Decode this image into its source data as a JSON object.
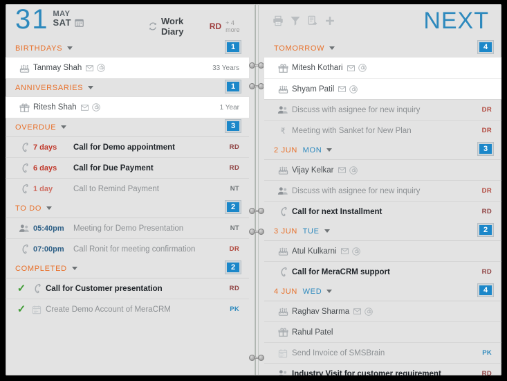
{
  "colors": {
    "accent_blue": "#2d89bd",
    "badge_blue": "#1b87c9",
    "orange": "#e8702a",
    "red": "#c0392b",
    "green": "#3f9c35"
  },
  "left_header": {
    "day_number": "31",
    "month": "MAY",
    "weekday": "SAT",
    "calendar_icon": "calendar-icon",
    "refresh_icon": "refresh-icon",
    "diary_title": "Work Diary",
    "diary_user": "RD",
    "diary_more": "+ 4 more"
  },
  "right_header": {
    "title": "NEXT",
    "tools": [
      {
        "name": "print-icon",
        "label": "Print"
      },
      {
        "name": "filter-icon",
        "label": "Filter"
      },
      {
        "name": "export-icon",
        "label": "Export"
      },
      {
        "name": "add-icon",
        "label": "Add"
      }
    ]
  },
  "left_sections": [
    {
      "title": "BIRTHDAYS",
      "count": "1",
      "white": true,
      "rows": [
        {
          "icon": "cake-icon",
          "name": "Tanmay Shah",
          "mini": [
            "mail-icon",
            "at-icon"
          ],
          "meta": "33 Years"
        }
      ]
    },
    {
      "title": "ANNIVERSARIES",
      "count": "1",
      "white": true,
      "rows": [
        {
          "icon": "gift-icon",
          "name": "Ritesh Shah",
          "mini": [
            "mail-icon",
            "at-icon"
          ],
          "meta": "1 Year"
        }
      ]
    },
    {
      "title": "OVERDUE",
      "count": "3",
      "white": false,
      "rows": [
        {
          "icon": "phone-icon",
          "time": "7 days",
          "time_style": "ovr",
          "task": "Call for Demo appointment",
          "task_bold": true,
          "label": "RD",
          "label_style": "rl-rd"
        },
        {
          "icon": "phone-icon",
          "time": "6 days",
          "time_style": "ovr",
          "task": "Call for Due Payment",
          "task_bold": true,
          "label": "RD",
          "label_style": "rl-rd"
        },
        {
          "icon": "phone-icon",
          "time": "1 day",
          "time_style": "ovrdim",
          "task": "Call to Remind Payment",
          "task_bold": false,
          "label": "NT",
          "label_style": "rl-nt"
        }
      ]
    },
    {
      "title": "TO DO",
      "count": "2",
      "white": false,
      "rows": [
        {
          "icon": "people-icon",
          "time": "05:40pm",
          "task": "Meeting for Demo Presentation",
          "task_bold": false,
          "label": "NT",
          "label_style": "rl-nt"
        },
        {
          "icon": "phone-icon",
          "time": "07:00pm",
          "task": "Call Ronit for meeting confirmation",
          "task_bold": false,
          "label": "DR",
          "label_style": "rl-dr"
        }
      ]
    },
    {
      "title": "COMPLETED",
      "count": "2",
      "white": false,
      "checks": true,
      "rows": [
        {
          "check": "✓",
          "icon": "phone-icon",
          "task": "Call  for Customer presentation",
          "task_bold": true,
          "label": "RD",
          "label_style": "rl-rd"
        },
        {
          "check": "✓",
          "icon": "calendar-icon",
          "task": "Create Demo Account of MeraCRM",
          "task_bold": false,
          "label": "PK",
          "label_style": "rl-pk"
        }
      ]
    }
  ],
  "right_sections": [
    {
      "title": "TOMORROW",
      "count": "4",
      "white_rows": 2,
      "rows": [
        {
          "icon": "gift-icon",
          "name": "Mitesh Kothari",
          "mini": [
            "mail-icon",
            "at-icon"
          ],
          "white": true
        },
        {
          "icon": "cake-icon",
          "name": "Shyam Patil",
          "mini": [
            "mail-icon",
            "at-icon"
          ],
          "white": true
        },
        {
          "icon": "people-icon",
          "task": "Discuss with asignee for new inquiry",
          "task_bold": false,
          "label": "DR",
          "label_style": "rl-dr"
        },
        {
          "icon": "rupee-icon",
          "task": "Meeting with Sanket for New Plan",
          "task_bold": false,
          "label": "DR",
          "label_style": "rl-dr"
        }
      ]
    },
    {
      "date": "2 JUN",
      "weekday": "MON",
      "count": "3",
      "rows": [
        {
          "icon": "cake-icon",
          "name": "Vijay Kelkar",
          "mini": [
            "mail-icon",
            "at-icon"
          ]
        },
        {
          "icon": "people-icon",
          "task": "Discuss with asignee for new inquiry",
          "task_bold": false,
          "label": "DR",
          "label_style": "rl-dr"
        },
        {
          "icon": "phone-icon",
          "task": "Call for next Installment",
          "task_bold": true,
          "label": "RD",
          "label_style": "rl-rd"
        }
      ]
    },
    {
      "date": "3 JUN",
      "weekday": "TUE",
      "count": "2",
      "rows": [
        {
          "icon": "cake-icon",
          "name": "Atul Kulkarni",
          "mini": [
            "mail-icon",
            "at-icon"
          ]
        },
        {
          "icon": "phone-icon",
          "task": "Call for MeraCRM support",
          "task_bold": true,
          "label": "RD",
          "label_style": "rl-rd"
        }
      ]
    },
    {
      "date": "4 JUN",
      "weekday": "WED",
      "count": "4",
      "rows": [
        {
          "icon": "cake-icon",
          "name": "Raghav Sharma",
          "mini": [
            "mail-icon",
            "at-icon"
          ]
        },
        {
          "icon": "gift-icon",
          "name": "Rahul Patel",
          "mini": []
        },
        {
          "icon": "calendar-icon",
          "task": "Send Invoice of SMSBrain",
          "task_bold": false,
          "label": "PK",
          "label_style": "rl-pk"
        },
        {
          "icon": "people-icon",
          "task": "Industry Visit for customer requirement",
          "task_bold": true,
          "label": "RD",
          "label_style": "rl-rd"
        }
      ]
    }
  ],
  "binder": {
    "ring_pairs": 3
  }
}
